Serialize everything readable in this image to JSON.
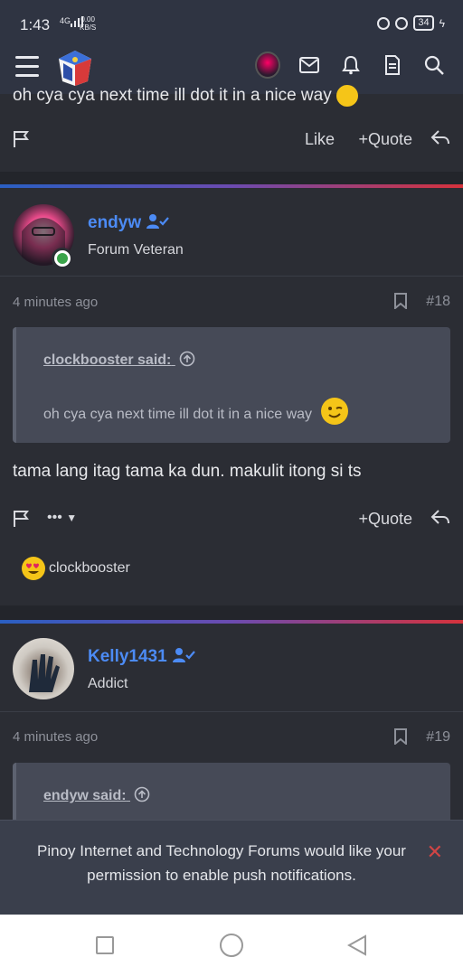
{
  "status_bar": {
    "time": "1:43",
    "signal": "4G",
    "speed_value": "0.00",
    "speed_unit": "KB/S",
    "battery": "34"
  },
  "header": {
    "icons": [
      "menu-icon",
      "site-logo",
      "user-avatar",
      "mail-icon",
      "bell-icon",
      "document-icon",
      "search-icon"
    ]
  },
  "previous_post": {
    "text_tail": "oh cya cya next time ill dot it in a nice way",
    "actions": {
      "like": "Like",
      "quote": "Quote"
    }
  },
  "posts": [
    {
      "username": "endyw",
      "user_title": "Forum Veteran",
      "time": "4 minutes ago",
      "number": "#18",
      "quote_author": "clockbooster said:",
      "quote_text": "oh cya cya next time ill dot it in a nice way",
      "body": "tama lang itag tama ka dun. makulit itong si ts",
      "more_label": "•••",
      "quote_label": "Quote",
      "reaction_user": "clockbooster"
    },
    {
      "username": "Kelly1431",
      "user_title": "Addict",
      "time": "4 minutes ago",
      "number": "#19",
      "quote_author": "endyw said:"
    }
  ],
  "push_notice": {
    "message": "Pinoy Internet and Technology Forums would like your permission to enable push notifications.",
    "close": "✕"
  },
  "colors": {
    "background": "#2b2d34",
    "accent_username": "#4c8bf5",
    "quote_bg": "#464a57"
  }
}
